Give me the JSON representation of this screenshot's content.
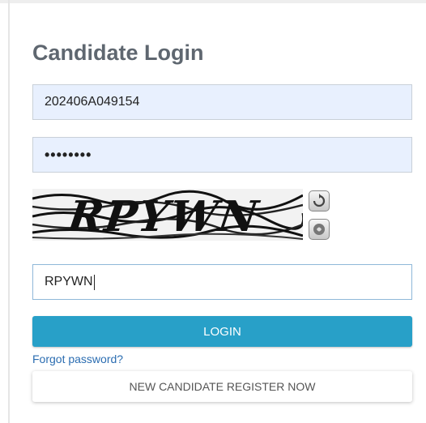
{
  "page": {
    "title": "Candidate Login"
  },
  "login_form": {
    "username_value": "202406A049154",
    "password_value": "••••••••",
    "captcha_image_text": "RPYWN",
    "captcha_input_value": "RPYWN",
    "login_label": "LOGIN",
    "forgot_label": "Forgot password?",
    "register_label": "NEW CANDIDATE REGISTER NOW"
  },
  "icons": {
    "refresh": "refresh-icon",
    "audio": "audio-icon"
  },
  "colors": {
    "login_button": "#28a0c8",
    "link": "#2b6db1",
    "autofill_bg": "#e8f0fe"
  }
}
